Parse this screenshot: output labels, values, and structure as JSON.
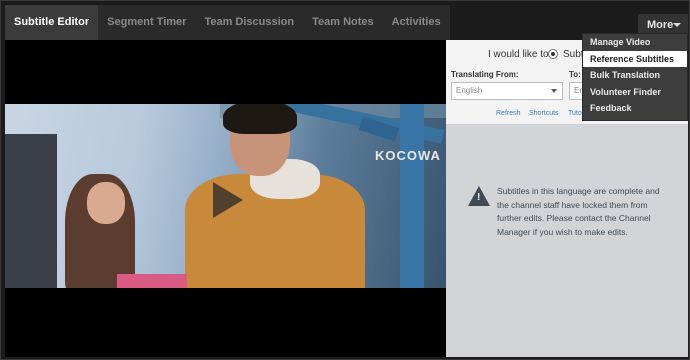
{
  "tabs": [
    {
      "label": "Subtitle Editor",
      "active": true
    },
    {
      "label": "Segment Timer",
      "active": false
    },
    {
      "label": "Team Discussion",
      "active": false
    },
    {
      "label": "Team Notes",
      "active": false
    },
    {
      "label": "Activities",
      "active": false
    }
  ],
  "more_button": {
    "label": "More"
  },
  "more_menu": {
    "items": [
      {
        "label": "Manage Video"
      },
      {
        "label": "Reference Subtitles",
        "highlighted": true
      },
      {
        "label": "Bulk Translation"
      },
      {
        "label": "Volunteer Finder"
      },
      {
        "label": "Feedback"
      }
    ]
  },
  "video": {
    "watermark": "KOCOWA",
    "play_icon": "play-icon"
  },
  "panel": {
    "would_like": "I would like to",
    "radio_option": "Subt",
    "translating_from_label": "Translating From:",
    "to_label": "To:",
    "from_value": "English",
    "to_value": "En",
    "links": [
      "Refresh",
      "Shortcuts",
      "Tuto"
    ],
    "notice_icon": "warning-icon",
    "notice": "Subtitles in this language are complete and the channel staff have locked them from further edits. Please contact the Channel Manager if you wish to make edits."
  },
  "colors": {
    "background": "#1b1b1b",
    "tab_active": "#3b3b3b",
    "panel": "#d2d4d8",
    "link": "#3d7bbf",
    "notice_text": "#3f4a56",
    "menu": "#3d3d3d"
  }
}
